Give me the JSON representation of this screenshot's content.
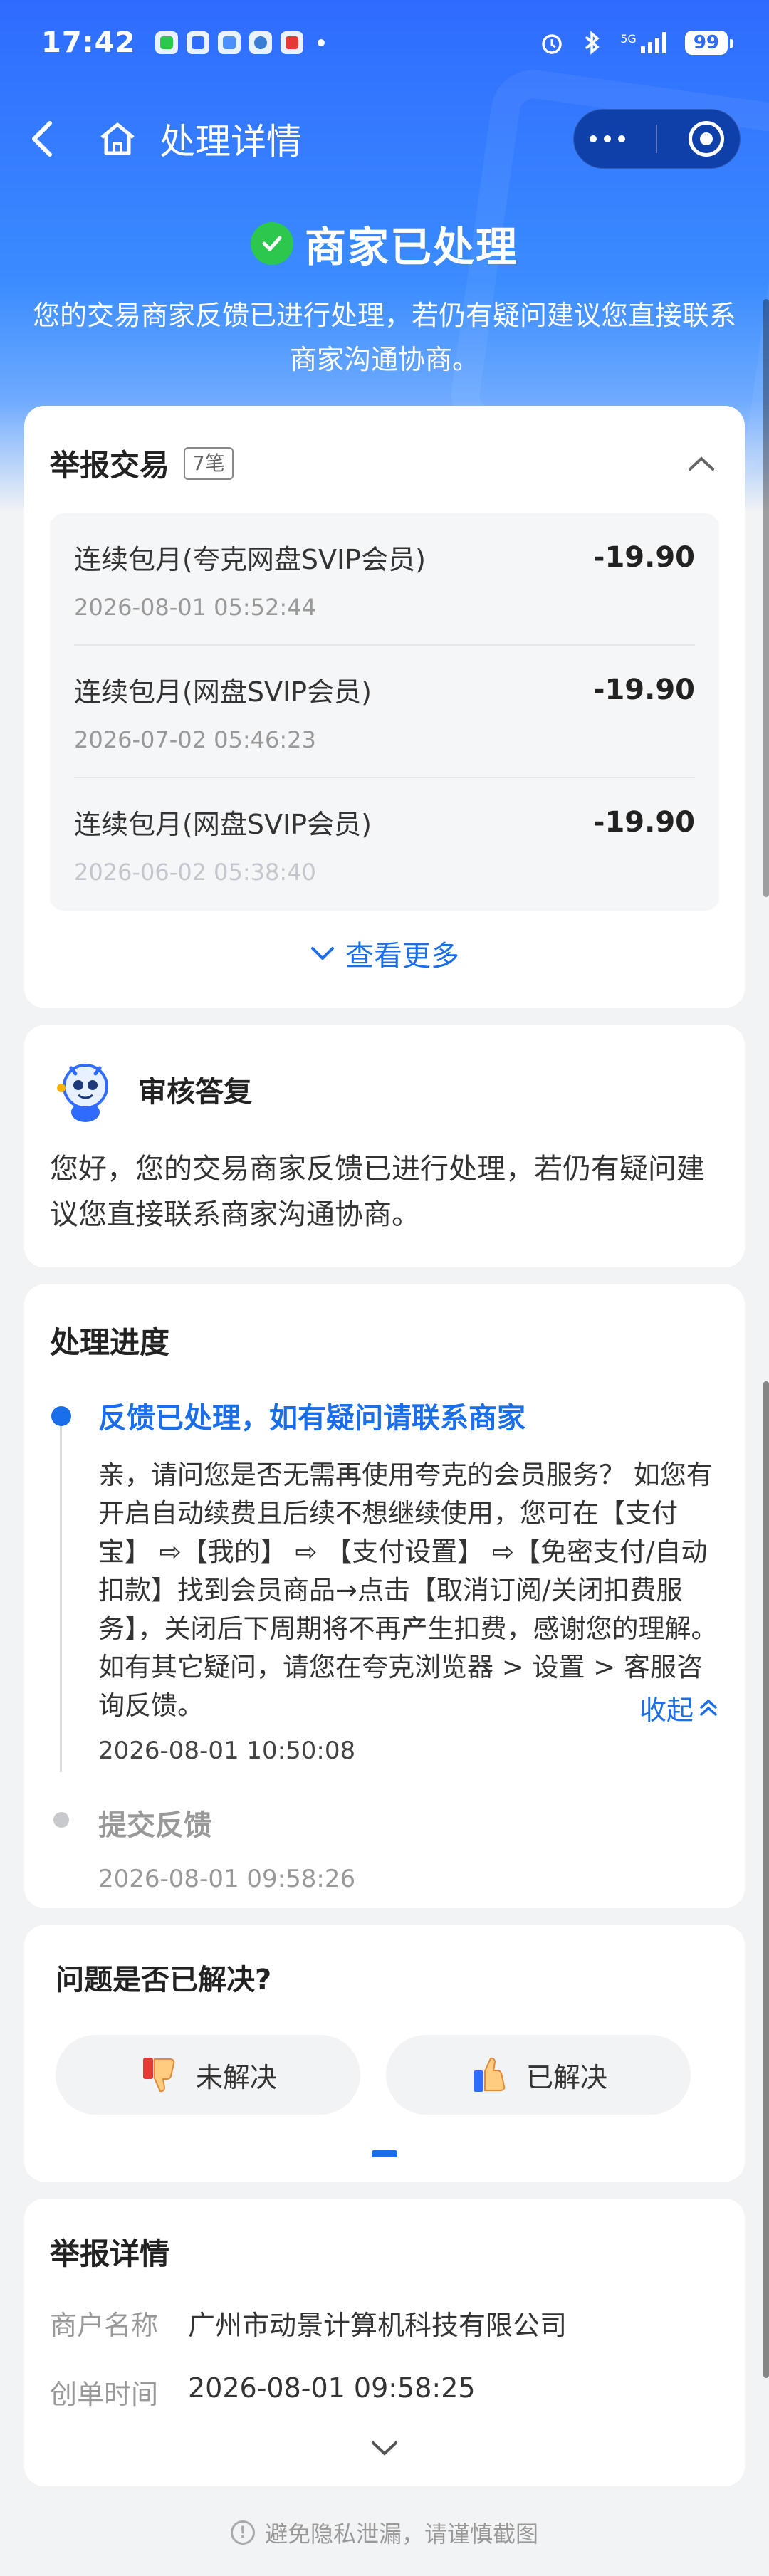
{
  "status_bar": {
    "time": "17:42",
    "network": "5G",
    "battery": "99"
  },
  "nav": {
    "title": "处理详情"
  },
  "hero": {
    "status_title": "商家已处理",
    "description": "您的交易商家反馈已进行处理，若仍有疑问建议您直接联系商家沟通协商。"
  },
  "trade": {
    "title": "举报交易",
    "count_badge": "7笔",
    "items": [
      {
        "name": "连续包月(夸克网盘SVIP会员)",
        "amount": "-19.90",
        "time": "2026-08-01 05:52:44"
      },
      {
        "name": "连续包月(网盘SVIP会员)",
        "amount": "-19.90",
        "time": "2026-07-02 05:46:23"
      },
      {
        "name": "连续包月(网盘SVIP会员)",
        "amount": "-19.90",
        "time": "2026-06-02 05:38:40"
      }
    ],
    "see_more": "查看更多"
  },
  "review": {
    "title": "审核答复",
    "text": "您好，您的交易商家反馈已进行处理，若仍有疑问建议您直接联系商家沟通协商。"
  },
  "progress": {
    "title": "处理进度",
    "steps": [
      {
        "title": "反馈已处理，如有疑问请联系商家",
        "content": "亲，请问您是否无需再使用夸克的会员服务？ 如您有开启自动续费且后续不想继续使用，您可在【支付宝】 ⇨【我的】 ⇨ 【支付设置】 ⇨【免密支付/自动扣款】找到会员商品→点击【取消订阅/关闭扣费服务】，关闭后下周期将不再产生扣费，感谢您的理解。 如有其它疑问，请您在夸克浏览器 > 设置 > 客服咨询反馈。",
        "time": "2026-08-01 10:50:08",
        "collapse": "收起"
      },
      {
        "title": "提交反馈",
        "time": "2026-08-01 09:58:26"
      }
    ]
  },
  "feedback": {
    "title": "问题是否已解决?",
    "unresolved": "未解决",
    "resolved": "已解决"
  },
  "details": {
    "title": "举报详情",
    "rows": [
      {
        "label": "商户名称",
        "value": "广州市动景计算机科技有限公司"
      },
      {
        "label": "创单时间",
        "value": "2026-08-01 09:58:25"
      }
    ]
  },
  "footer": {
    "note": "避免隐私泄漏，请谨慎截图"
  },
  "colors": {
    "brand_blue": "#1a6eea",
    "hero_blue": "#2f6bff",
    "success_green": "#2cc84d"
  }
}
